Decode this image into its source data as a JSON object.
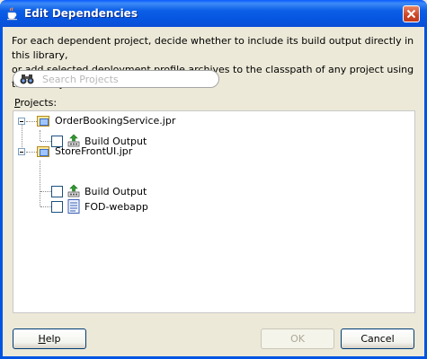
{
  "window": {
    "title": "Edit Dependencies"
  },
  "description": {
    "line1": "For each dependent project, decide whether to include its build output directly in this library,",
    "line2": "or add selected deployment profile archives to the classpath of any project using this library."
  },
  "search": {
    "placeholder": "Search Projects",
    "value": ""
  },
  "projects_label": {
    "first": "P",
    "rest": "rojects:"
  },
  "tree": {
    "projects": [
      {
        "label": "OrderBookingService.jpr",
        "icon": "project-folder-icon",
        "children": [
          {
            "label": "Build Output",
            "icon": "build-output-icon",
            "checked": false
          }
        ]
      },
      {
        "label": "StoreFrontUI.jpr",
        "icon": "project-folder-icon",
        "children": [
          {
            "label": "Build Output",
            "icon": "build-output-icon",
            "checked": false
          },
          {
            "label": "FOD-webapp",
            "icon": "deployment-profile-icon",
            "checked": false
          }
        ]
      }
    ]
  },
  "buttons": {
    "help_first": "H",
    "help_rest": "elp",
    "ok": "OK",
    "ok_enabled": false,
    "cancel": "Cancel"
  },
  "colors": {
    "titlebar": "#0054e3",
    "dialog_bg": "#ece9d8",
    "close_button": "#cc4426"
  }
}
